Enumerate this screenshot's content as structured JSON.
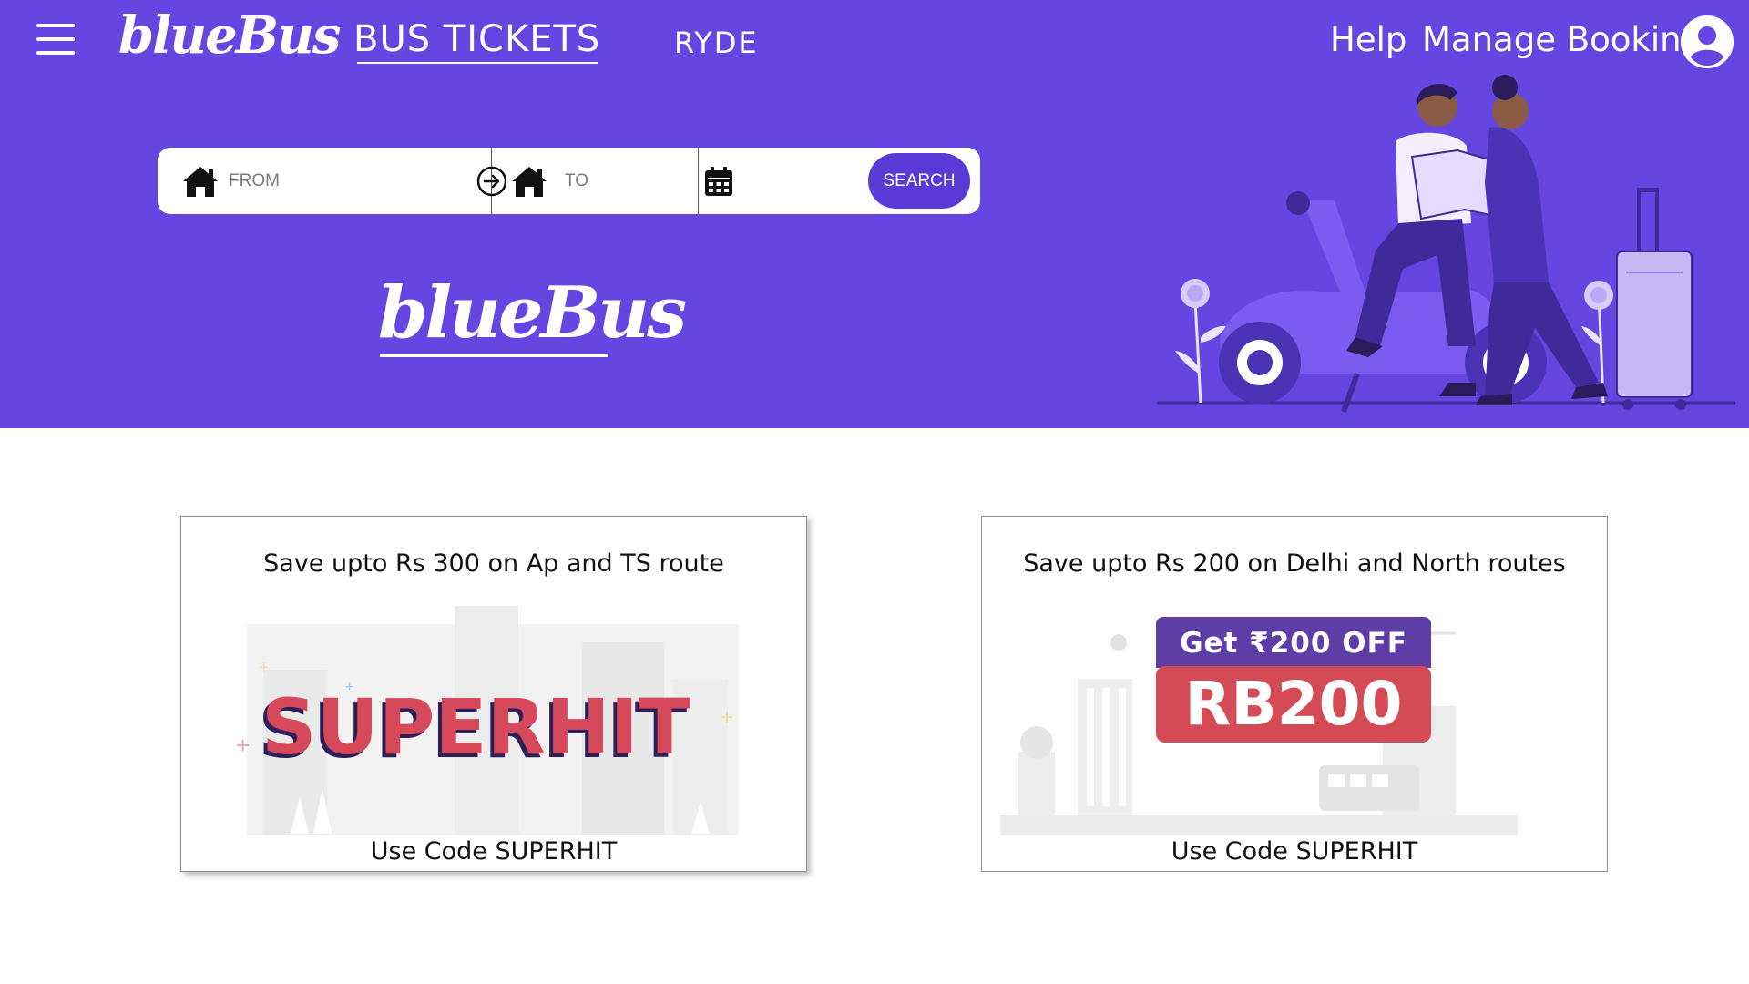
{
  "header": {
    "brand": "blueBus",
    "nav_bus_tickets": "BUS TICKETS",
    "nav_ryde": "RYDE",
    "nav_help": "Help",
    "nav_manage_booking": "Manage Booking"
  },
  "search": {
    "from_placeholder": "FROM",
    "to_placeholder": "TO",
    "search_label": "SEARCH"
  },
  "hero": {
    "logo": "blueBus"
  },
  "offers": [
    {
      "title": "Save upto Rs 300 on Ap and TS route",
      "banner_text": "SUPERHIT",
      "code_text": "Use Code SUPERHIT"
    },
    {
      "title": "Save upto Rs 200 on Delhi and North routes",
      "banner_top": "Get ₹200 OFF",
      "banner_main": "RB200",
      "code_text": "Use Code SUPERHIT"
    }
  ],
  "colors": {
    "hero_bg": "#6646e0",
    "search_button": "#5a3ad6",
    "offer_red": "#d44a55",
    "offer_purple": "#5e3ea6"
  },
  "icons": [
    "menu-icon",
    "user-icon",
    "home-icon",
    "arrow-right-circle-icon",
    "calendar-icon"
  ]
}
